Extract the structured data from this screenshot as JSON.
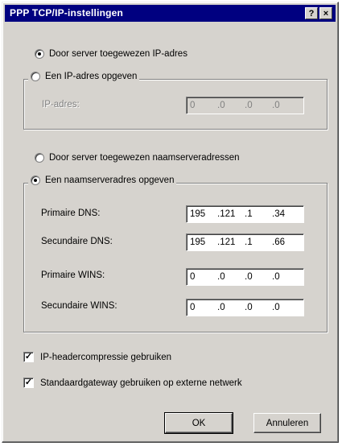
{
  "window": {
    "title": "PPP TCP/IP-instellingen",
    "help_glyph": "?",
    "close_glyph": "×"
  },
  "ip_section": {
    "auto_option": "Door server toegewezen IP-adres",
    "manual_option": "Een IP-adres opgeven",
    "ip_label": "IP-adres:",
    "ip_value": [
      "0",
      "0",
      "0",
      "0"
    ],
    "auto_selected": true
  },
  "dns_section": {
    "auto_option": "Door server toegewezen naamserveradressen",
    "manual_option": "Een naamserveradres opgeven",
    "manual_selected": true,
    "fields": [
      {
        "label": "Primaire DNS:",
        "value": [
          "195",
          "121",
          "1",
          "34"
        ]
      },
      {
        "label": "Secundaire DNS:",
        "value": [
          "195",
          "121",
          "1",
          "66"
        ]
      },
      {
        "label": "Primaire WINS:",
        "value": [
          "0",
          "0",
          "0",
          "0"
        ]
      },
      {
        "label": "Secundaire WINS:",
        "value": [
          "0",
          "0",
          "0",
          "0"
        ]
      }
    ]
  },
  "options": {
    "header_compression": {
      "label": "IP-headercompressie gebruiken",
      "checked": true
    },
    "default_gateway": {
      "label": "Standaardgateway gebruiken op externe netwerk",
      "checked": true
    }
  },
  "buttons": {
    "ok": "OK",
    "cancel": "Annuleren"
  },
  "colors": {
    "titlebar": "#000080",
    "face": "#d6d3ce"
  }
}
